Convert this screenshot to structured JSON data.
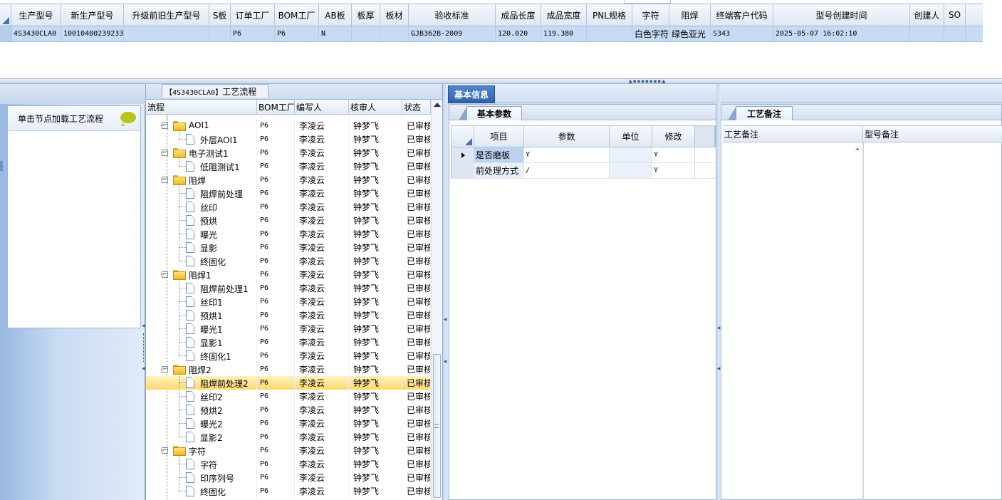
{
  "top_grid": {
    "columns": [
      "生产型号",
      "新生产型号",
      "升级前旧生产型号",
      "S板",
      "订单工厂",
      "BOM工厂",
      "AB板",
      "板厚",
      "板材",
      "验收标准",
      "成品长度",
      "成品宽度",
      "PNL规格",
      "字符",
      "阻焊",
      "终端客户代码",
      "型号创建时间",
      "创建人",
      "SO"
    ],
    "row": [
      "4S3430CLA0",
      "10010400239233",
      "",
      "",
      "P6",
      "P6",
      "N",
      "",
      "",
      "GJB362B-2009",
      "120.020",
      "119.380",
      "",
      "白色字符",
      "绿色亚光",
      "S343",
      "2025-05-07 16:02:10",
      "",
      ""
    ]
  },
  "left_nav": {
    "load_button": "单击节点加载工艺流程"
  },
  "tree_panel": {
    "title_code": "【4S3430CLA0】",
    "title_text": "工艺流程",
    "columns": [
      "流程",
      "BOM工厂",
      "编写人",
      "核审人",
      "状态"
    ],
    "rows": [
      {
        "level": 0,
        "type": "folder",
        "name": "AOI1",
        "bom": "P6",
        "writer": "李凌云",
        "reviewer": "钟梦飞",
        "status": "已审核"
      },
      {
        "level": 1,
        "type": "doc",
        "name": "外层AOI1",
        "bom": "P6",
        "writer": "李凌云",
        "reviewer": "钟梦飞",
        "status": "已审核"
      },
      {
        "level": 0,
        "type": "folder",
        "name": "电子测试1",
        "bom": "P6",
        "writer": "李凌云",
        "reviewer": "钟梦飞",
        "status": "已审核"
      },
      {
        "level": 1,
        "type": "doc",
        "name": "低阻测试1",
        "bom": "P6",
        "writer": "李凌云",
        "reviewer": "钟梦飞",
        "status": "已审核"
      },
      {
        "level": 0,
        "type": "folder",
        "name": "阻焊",
        "bom": "P6",
        "writer": "李凌云",
        "reviewer": "钟梦飞",
        "status": "已审核"
      },
      {
        "level": 1,
        "type": "doc",
        "name": "阻焊前处理",
        "bom": "P6",
        "writer": "李凌云",
        "reviewer": "钟梦飞",
        "status": "已审核"
      },
      {
        "level": 1,
        "type": "doc",
        "name": "丝印",
        "bom": "P6",
        "writer": "李凌云",
        "reviewer": "钟梦飞",
        "status": "已审核"
      },
      {
        "level": 1,
        "type": "doc",
        "name": "预烘",
        "bom": "P6",
        "writer": "李凌云",
        "reviewer": "钟梦飞",
        "status": "已审核"
      },
      {
        "level": 1,
        "type": "doc",
        "name": "曝光",
        "bom": "P6",
        "writer": "李凌云",
        "reviewer": "钟梦飞",
        "status": "已审核"
      },
      {
        "level": 1,
        "type": "doc",
        "name": "显影",
        "bom": "P6",
        "writer": "李凌云",
        "reviewer": "钟梦飞",
        "status": "已审核"
      },
      {
        "level": 1,
        "type": "doc",
        "name": "终固化",
        "bom": "P6",
        "writer": "李凌云",
        "reviewer": "钟梦飞",
        "status": "已审核"
      },
      {
        "level": 0,
        "type": "folder",
        "name": "阻焊1",
        "bom": "P6",
        "writer": "李凌云",
        "reviewer": "钟梦飞",
        "status": "已审核"
      },
      {
        "level": 1,
        "type": "doc",
        "name": "阻焊前处理1",
        "bom": "P6",
        "writer": "李凌云",
        "reviewer": "钟梦飞",
        "status": "已审核"
      },
      {
        "level": 1,
        "type": "doc",
        "name": "丝印1",
        "bom": "P6",
        "writer": "李凌云",
        "reviewer": "钟梦飞",
        "status": "已审核"
      },
      {
        "level": 1,
        "type": "doc",
        "name": "预烘1",
        "bom": "P6",
        "writer": "李凌云",
        "reviewer": "钟梦飞",
        "status": "已审核"
      },
      {
        "level": 1,
        "type": "doc",
        "name": "曝光1",
        "bom": "P6",
        "writer": "李凌云",
        "reviewer": "钟梦飞",
        "status": "已审核"
      },
      {
        "level": 1,
        "type": "doc",
        "name": "显影1",
        "bom": "P6",
        "writer": "李凌云",
        "reviewer": "钟梦飞",
        "status": "已审核"
      },
      {
        "level": 1,
        "type": "doc",
        "name": "终固化1",
        "bom": "P6",
        "writer": "李凌云",
        "reviewer": "钟梦飞",
        "status": "已审核"
      },
      {
        "level": 0,
        "type": "folder",
        "name": "阻焊2",
        "bom": "P6",
        "writer": "李凌云",
        "reviewer": "钟梦飞",
        "status": "已审核"
      },
      {
        "level": 1,
        "type": "doc",
        "name": "阻焊前处理2",
        "bom": "P6",
        "writer": "李凌云",
        "reviewer": "钟梦飞",
        "status": "已审核",
        "selected": true
      },
      {
        "level": 1,
        "type": "doc",
        "name": "丝印2",
        "bom": "P6",
        "writer": "李凌云",
        "reviewer": "钟梦飞",
        "status": "已审核"
      },
      {
        "level": 1,
        "type": "doc",
        "name": "预烘2",
        "bom": "P6",
        "writer": "李凌云",
        "reviewer": "钟梦飞",
        "status": "已审核"
      },
      {
        "level": 1,
        "type": "doc",
        "name": "曝光2",
        "bom": "P6",
        "writer": "李凌云",
        "reviewer": "钟梦飞",
        "status": "已审核"
      },
      {
        "level": 1,
        "type": "doc",
        "name": "显影2",
        "bom": "P6",
        "writer": "李凌云",
        "reviewer": "钟梦飞",
        "status": "已审核"
      },
      {
        "level": 0,
        "type": "folder",
        "name": "字符",
        "bom": "P6",
        "writer": "李凌云",
        "reviewer": "钟梦飞",
        "status": "已审核"
      },
      {
        "level": 1,
        "type": "doc",
        "name": "字符",
        "bom": "P6",
        "writer": "李凌云",
        "reviewer": "钟梦飞",
        "status": "已审核"
      },
      {
        "level": 1,
        "type": "doc",
        "name": "印序列号",
        "bom": "P6",
        "writer": "李凌云",
        "reviewer": "钟梦飞",
        "status": "已审核"
      },
      {
        "level": 1,
        "type": "doc",
        "name": "终固化",
        "bom": "P6",
        "writer": "李凌云",
        "reviewer": "钟梦飞",
        "status": "已审核"
      }
    ]
  },
  "info_panel": {
    "tab": "基本信息",
    "params_tab": "基本参数",
    "params_columns": [
      "项目",
      "参数",
      "单位",
      "修改"
    ],
    "params_rows": [
      {
        "item": "是否磨板",
        "param": "Y",
        "unit": "",
        "modify": "Y"
      },
      {
        "item": "前处理方式",
        "param": "/",
        "unit": "",
        "modify": "Y"
      }
    ],
    "remarks_tab": "工艺备注",
    "remarks_columns": [
      "工艺备注",
      "型号备注"
    ]
  },
  "colors": {
    "accent": "#2e62ad",
    "selection": "#ffd86b",
    "folder": "#f0b81c"
  }
}
